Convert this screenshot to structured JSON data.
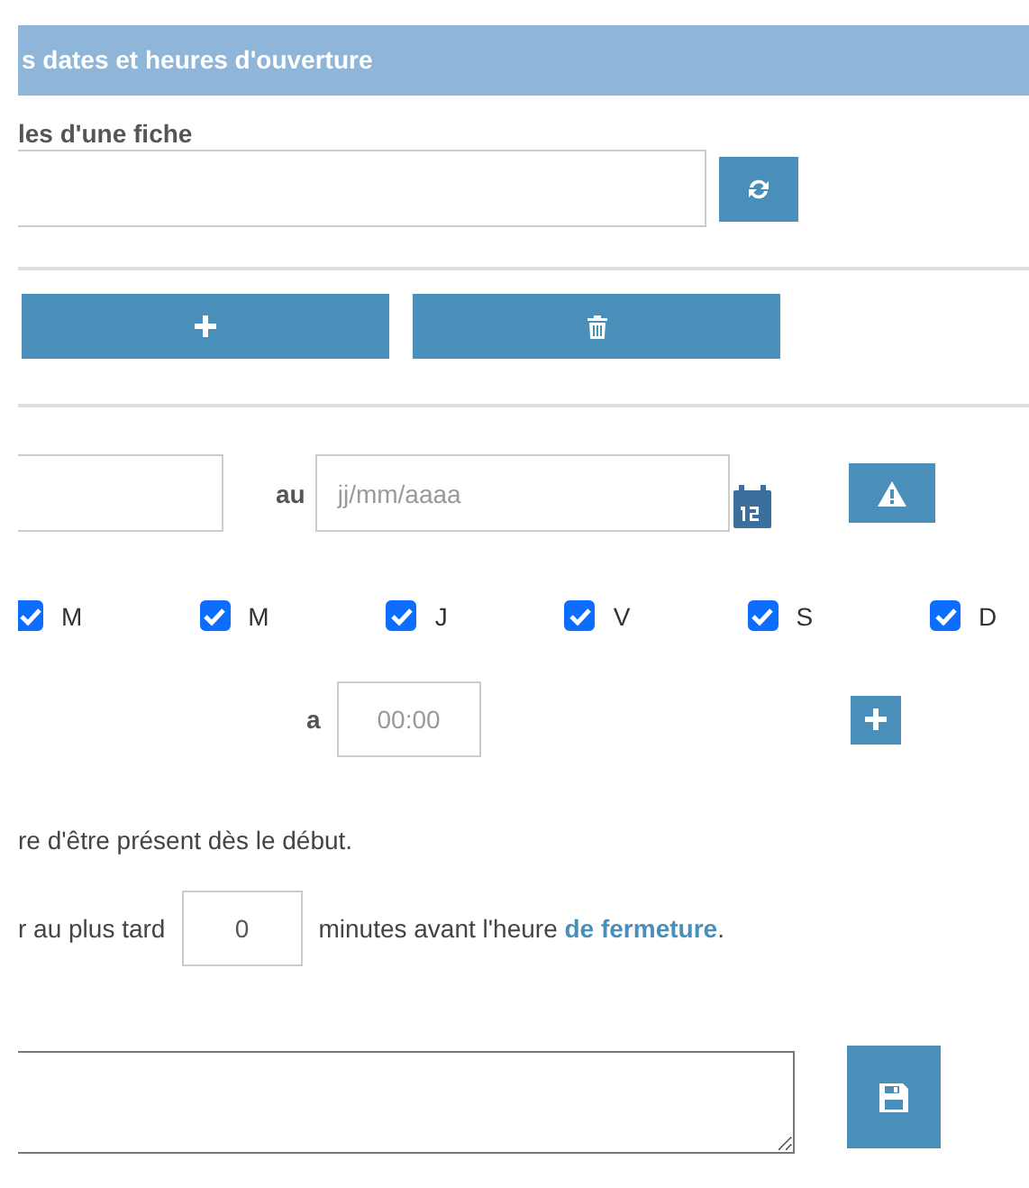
{
  "header": {
    "title": "s dates et heures d'ouverture"
  },
  "fiche": {
    "label": "les d'une fiche"
  },
  "date_range": {
    "separator": "au",
    "to": {
      "placeholder": "jj/mm/aaaa"
    }
  },
  "days": [
    {
      "label": "M",
      "checked": true
    },
    {
      "label": "M",
      "checked": true
    },
    {
      "label": "J",
      "checked": true
    },
    {
      "label": "V",
      "checked": true
    },
    {
      "label": "S",
      "checked": true
    },
    {
      "label": "D",
      "checked": true
    }
  ],
  "time": {
    "label": "a",
    "placeholder": "00:00"
  },
  "note": "re d'être présent dès le début.",
  "delay": {
    "prefix": "r au plus tard",
    "value": "0",
    "suffix": "minutes avant l'heure ",
    "link": "de fermeture",
    "end": "."
  }
}
